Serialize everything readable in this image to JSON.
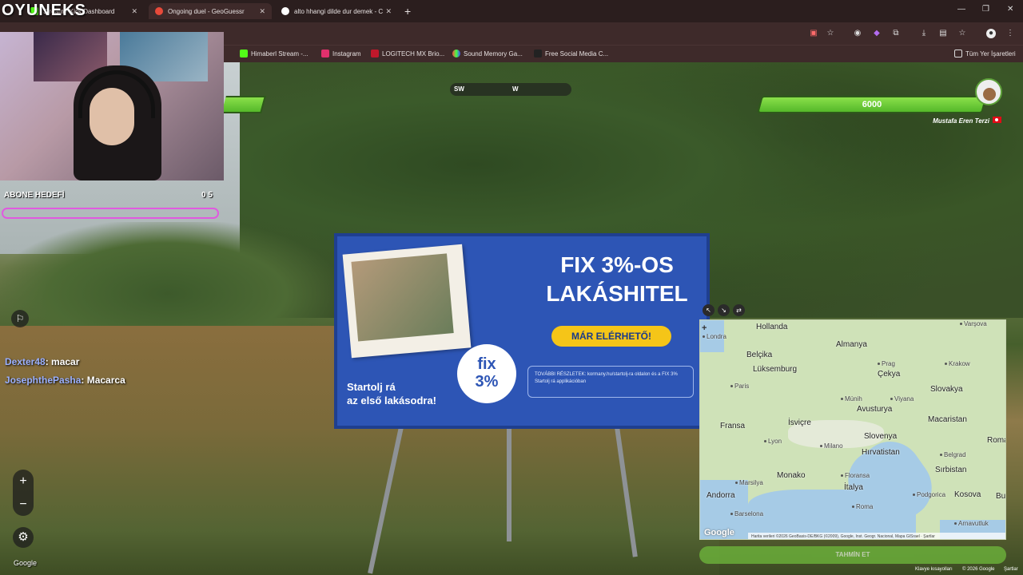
{
  "browser": {
    "tabs": [
      {
        "title": "Stream - Kick Dashboard",
        "active": false
      },
      {
        "title": "Ongoing duel - GeoGuessr",
        "active": true
      },
      {
        "title": "alto hhangi dilde dur demek - C",
        "active": false
      }
    ],
    "bookmarks": [
      "Himaberl Stream -...",
      "Instagram",
      "LOGITECH MX Brio...",
      "Sound Memory Ga...",
      "Free Social Media C...",
      "Tüm Yer İşaretleri"
    ]
  },
  "stream": {
    "logo": "OYUNEKS",
    "goal_label": "ABONE HEDEFİ",
    "goal_current": "0",
    "goal_target": "5",
    "goal_progress": 0,
    "chat": [
      {
        "user": "Dexter48",
        "message": ": macar"
      },
      {
        "user": "JosephthePasha",
        "message": ": Macarca"
      }
    ]
  },
  "game": {
    "compass": {
      "left": "SW",
      "center": "W"
    },
    "opponent": {
      "name": "Mustafa Eren Terzi",
      "health": "6000"
    },
    "guess_button": "TAHMİN ET",
    "google_label": "Google",
    "keyboard_shortcuts": "Klavye kısayolları",
    "copyright": "© 2026 Google",
    "terms": "Şartlar"
  },
  "billboard": {
    "headline_1": "FIX 3%-OS",
    "headline_2": "LAKÁSHITEL",
    "cta": "MÁR ELÉRHETŐ!",
    "seal_1": "fix",
    "seal_2": "3%",
    "tagline_1": "Startolj rá",
    "tagline_2": "az első lakásodra!",
    "info": "TOVÁBBI RÉSZLETEK: kormany.hu/startolj-ra oldalon és a FIX 3% Startolj rá applikációban"
  },
  "map": {
    "countries": [
      {
        "name": "Hollanda"
      },
      {
        "name": "Almanya"
      },
      {
        "name": "Belçika"
      },
      {
        "name": "Lüksemburg"
      },
      {
        "name": "Çekya"
      },
      {
        "name": "Slovakya"
      },
      {
        "name": "Avusturya"
      },
      {
        "name": "Fransa"
      },
      {
        "name": "İsviçre"
      },
      {
        "name": "Slovenya"
      },
      {
        "name": "Macaristan"
      },
      {
        "name": "Hırvatistan"
      },
      {
        "name": "Roma"
      },
      {
        "name": "Monako"
      },
      {
        "name": "İtalya"
      },
      {
        "name": "Sırbistan"
      },
      {
        "name": "Andorra"
      },
      {
        "name": "Kosova"
      },
      {
        "name": "Bulg"
      }
    ],
    "cities": [
      {
        "name": "Varşova"
      },
      {
        "name": "Londra"
      },
      {
        "name": "Prag"
      },
      {
        "name": "Krakow"
      },
      {
        "name": "Paris"
      },
      {
        "name": "Münih"
      },
      {
        "name": "Viyana"
      },
      {
        "name": "Lyon"
      },
      {
        "name": "Milano"
      },
      {
        "name": "Belgrad"
      },
      {
        "name": "Marsilya"
      },
      {
        "name": "Floransa"
      },
      {
        "name": "Barselona"
      },
      {
        "name": "Podgorica"
      },
      {
        "name": "Roma"
      },
      {
        "name": "Arnavutluk"
      }
    ],
    "attribution": "Harita verileri ©2026 GeoBasis-DE/BKG (©2009), Google, Inst. Geogr. Nacional, Mapa GISrael",
    "terms": "Şartlar",
    "google": "Google"
  },
  "colors": {
    "health_green": "#6ccc3a",
    "goal_pink": "#e05adf",
    "chat_user": "#9ab0ff"
  }
}
